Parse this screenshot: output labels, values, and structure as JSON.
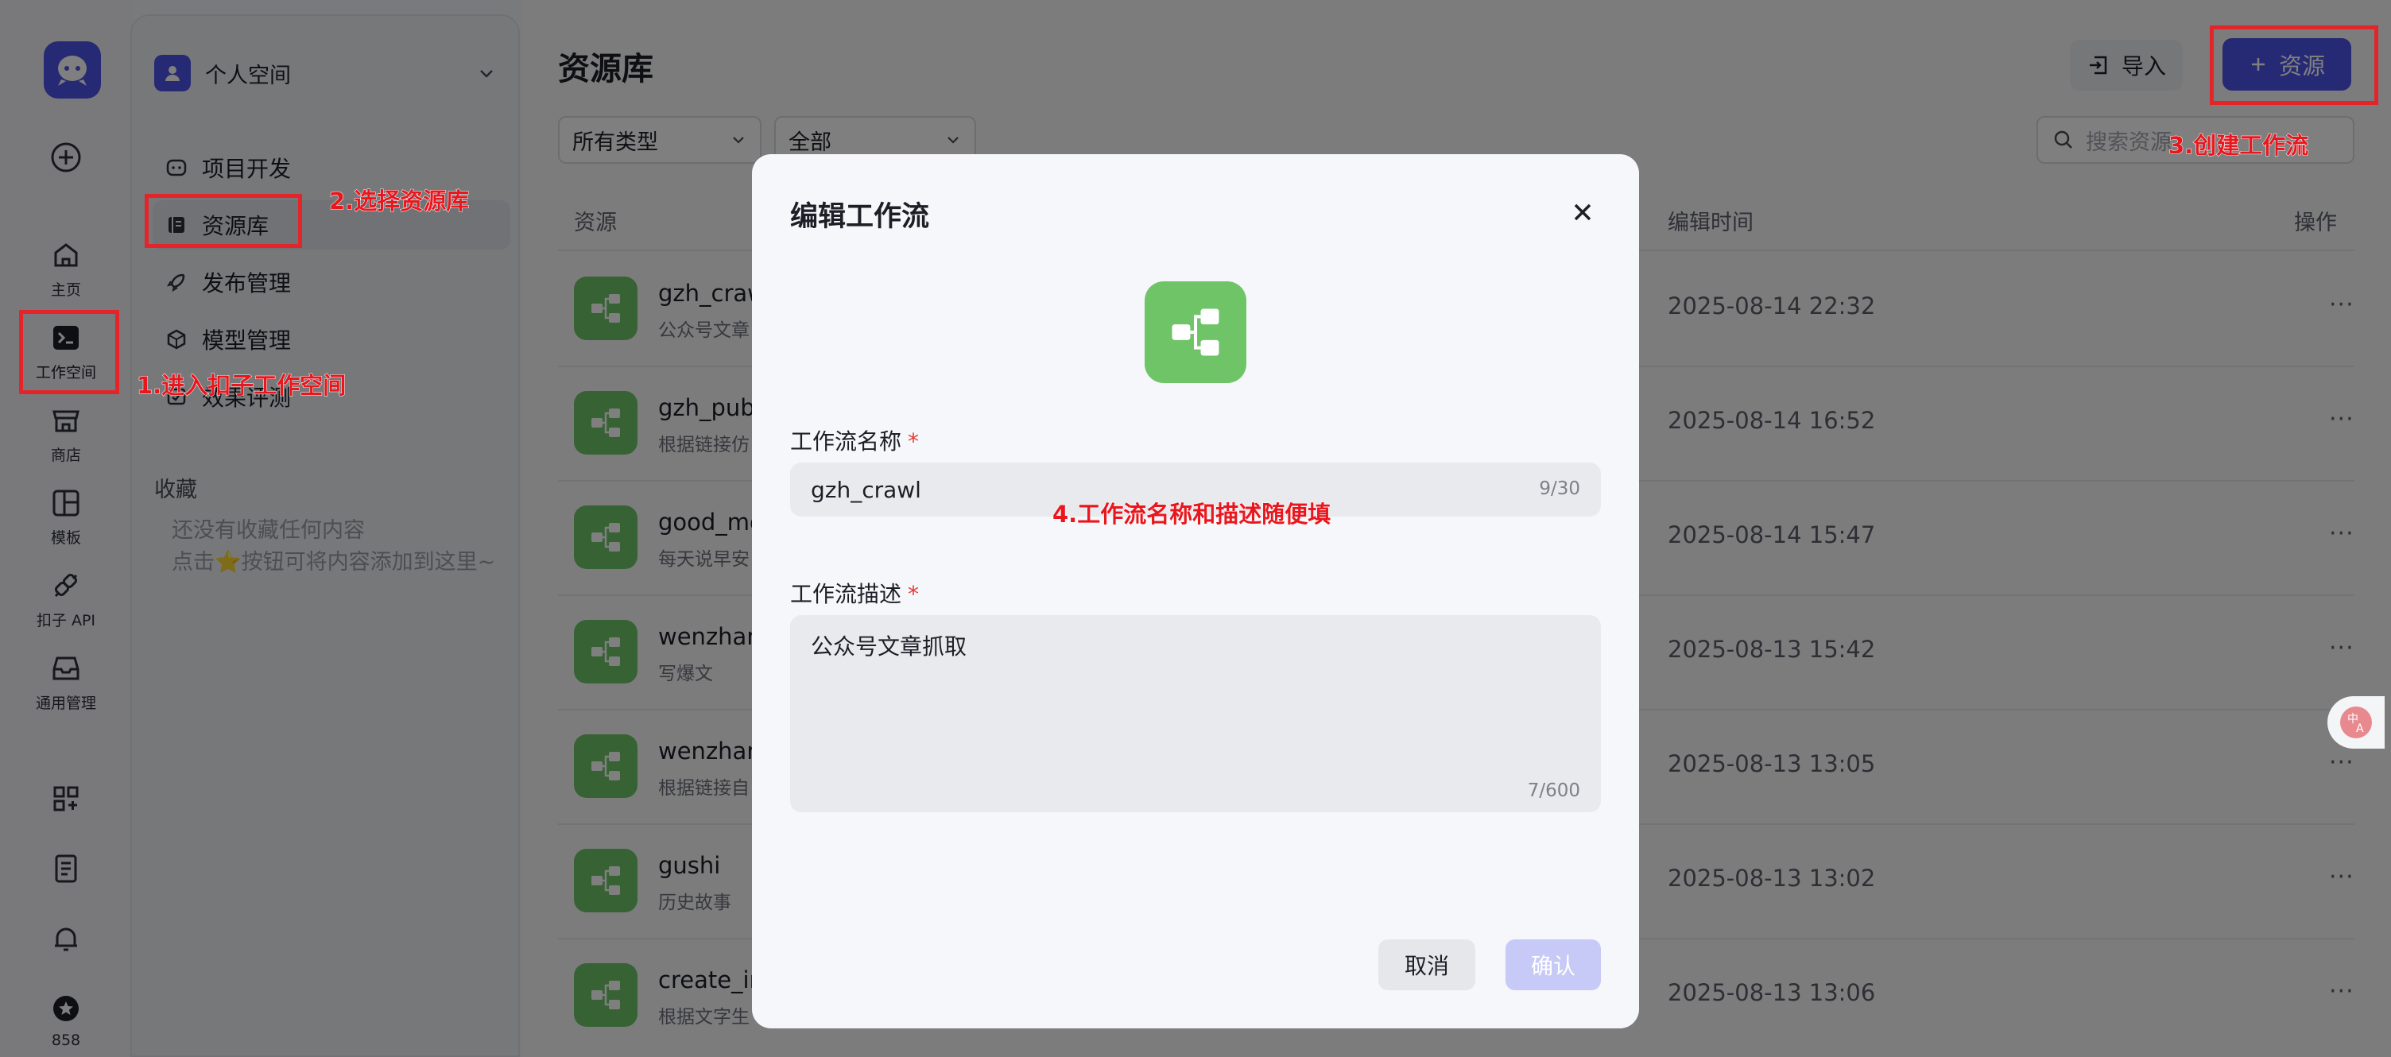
{
  "rail": {
    "items": [
      {
        "label": "主页"
      },
      {
        "label": "工作空间"
      },
      {
        "label": "商店"
      },
      {
        "label": "模板"
      },
      {
        "label": "扣子 API"
      },
      {
        "label": "通用管理"
      }
    ],
    "credits": "858"
  },
  "sidebar": {
    "space_name": "个人空间",
    "nav": [
      {
        "label": "项目开发"
      },
      {
        "label": "资源库"
      },
      {
        "label": "发布管理"
      },
      {
        "label": "模型管理"
      },
      {
        "label": "效果评测"
      }
    ],
    "favorites_title": "收藏",
    "favorites_empty_line1": "还没有收藏任何内容",
    "favorites_empty_line2": "点击⭐按钮可将内容添加到这里~"
  },
  "main": {
    "title": "资源库",
    "import_label": "导入",
    "add_resource_label": "资源",
    "filter_type": "所有类型",
    "filter_scope": "全部",
    "search_placeholder": "搜索资源",
    "columns": {
      "resource": "资源",
      "edit_time": "编辑时间",
      "actions": "操作"
    },
    "rows": [
      {
        "name": "gzh_crawl",
        "desc": "公众号文章",
        "time": "2025-08-14 22:32"
      },
      {
        "name": "gzh_publi",
        "desc": "根据链接仿",
        "time": "2025-08-14 16:52"
      },
      {
        "name": "good_mo",
        "desc": "每天说早安",
        "time": "2025-08-14 15:47"
      },
      {
        "name": "wenzhang",
        "desc": "写爆文",
        "time": "2025-08-13 15:42"
      },
      {
        "name": "wenzhang",
        "desc": "根据链接自",
        "time": "2025-08-13 13:05"
      },
      {
        "name": "gushi",
        "desc": "历史故事",
        "time": "2025-08-13 13:02"
      },
      {
        "name": "create_im",
        "desc": "根据文字生",
        "time": "2025-08-13 13:06"
      }
    ],
    "more_glyph": "···"
  },
  "modal": {
    "title": "编辑工作流",
    "name_label": "工作流名称",
    "name_value": "gzh_crawl",
    "name_count": "9/30",
    "desc_label": "工作流描述",
    "desc_value": "公众号文章抓取",
    "desc_count": "7/600",
    "cancel_label": "取消",
    "confirm_label": "确认",
    "required_mark": "*"
  },
  "annotations": {
    "step1": "1.进入扣子工作空间",
    "step2": "2.选择资源库",
    "step3": "3.创建工作流",
    "step4": "4.工作流名称和描述随便填"
  },
  "colors": {
    "brand": "#4d53e8",
    "workflow_icon": "#6fc468",
    "annotation_red": "#e3252a",
    "required": "#e63a35"
  }
}
